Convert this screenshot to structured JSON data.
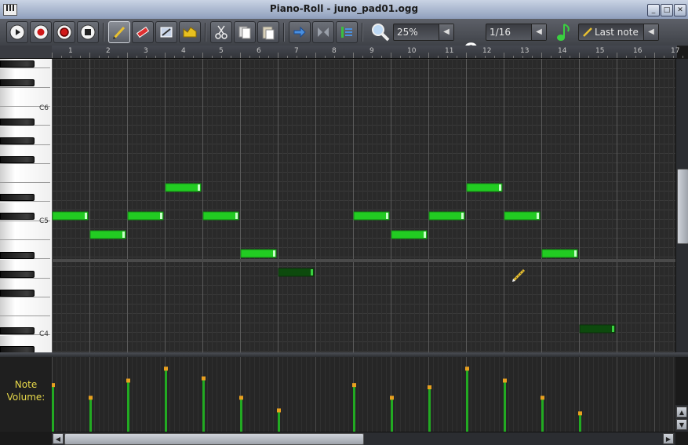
{
  "window": {
    "title": "Piano-Roll - juno_pad01.ogg",
    "buttons": [
      "_",
      "□",
      "✕"
    ]
  },
  "toolbar": {
    "zoom_value": "25%",
    "quantize_label": "Q",
    "quantize_value": "1/16",
    "note_length_value": "Last note"
  },
  "ruler": {
    "bars": [
      "1",
      "2",
      "3",
      "4",
      "5",
      "6",
      "7",
      "8",
      "9",
      "10",
      "11",
      "12",
      "13",
      "14",
      "15",
      "16",
      "17"
    ]
  },
  "keyboard": {
    "labels": [
      "C6",
      "C5",
      "C4"
    ]
  },
  "volume_panel": {
    "label_line1": "Note",
    "label_line2": "Volume:"
  },
  "colors": {
    "note_active": "#22cc22",
    "note_dim": "#0d4a0d",
    "grid_bg": "#2a2a2a",
    "volume_marker": "#e8a020"
  },
  "notes": [
    {
      "beat": 0,
      "row": "G",
      "len": 1,
      "volume": 0.63
    },
    {
      "beat": 1,
      "row": "F",
      "len": 1,
      "volume": 0.46
    },
    {
      "beat": 2,
      "row": "G",
      "len": 1,
      "volume": 0.69
    },
    {
      "beat": 3,
      "row": "A",
      "len": 1,
      "volume": 0.85
    },
    {
      "beat": 4,
      "row": "G",
      "len": 1,
      "volume": 0.72
    },
    {
      "beat": 5,
      "row": "E",
      "len": 1,
      "volume": 0.46
    },
    {
      "beat": 6,
      "row": "C",
      "len": 1,
      "volume": 0.29
    },
    {
      "beat": 8,
      "row": "G",
      "len": 1,
      "volume": 0.63
    },
    {
      "beat": 9,
      "row": "F",
      "len": 1,
      "volume": 0.46
    },
    {
      "beat": 10,
      "row": "G",
      "len": 1,
      "volume": 0.6
    },
    {
      "beat": 11,
      "row": "A",
      "len": 1,
      "volume": 0.85
    },
    {
      "beat": 12,
      "row": "G",
      "len": 1,
      "volume": 0.69
    },
    {
      "beat": 13,
      "row": "E",
      "len": 1,
      "volume": 0.46
    },
    {
      "beat": 14,
      "row": "A#3",
      "len": 1,
      "volume": 0.25
    }
  ]
}
